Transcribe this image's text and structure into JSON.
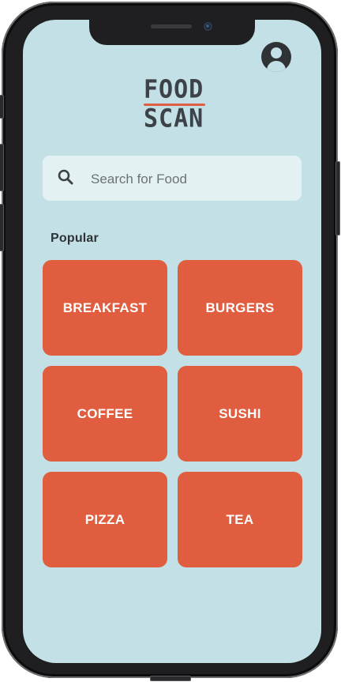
{
  "app": {
    "logo_line1": "FOOD",
    "logo_line2": "SCAN",
    "profile_icon": "user-circle-icon"
  },
  "search": {
    "placeholder": "Search for Food",
    "value": "",
    "icon": "search-icon"
  },
  "popular": {
    "title": "Popular",
    "categories": [
      {
        "label": "BREAKFAST"
      },
      {
        "label": "BURGERS"
      },
      {
        "label": "COFFEE"
      },
      {
        "label": "SUSHI"
      },
      {
        "label": "PIZZA"
      },
      {
        "label": "TEA"
      }
    ]
  },
  "colors": {
    "screen_background": "#c2e0e5",
    "search_background": "#e3f1f3",
    "tile_accent": "#e05d3f",
    "text_dark": "#2f3336",
    "phone_frame": "#1f1f21"
  }
}
